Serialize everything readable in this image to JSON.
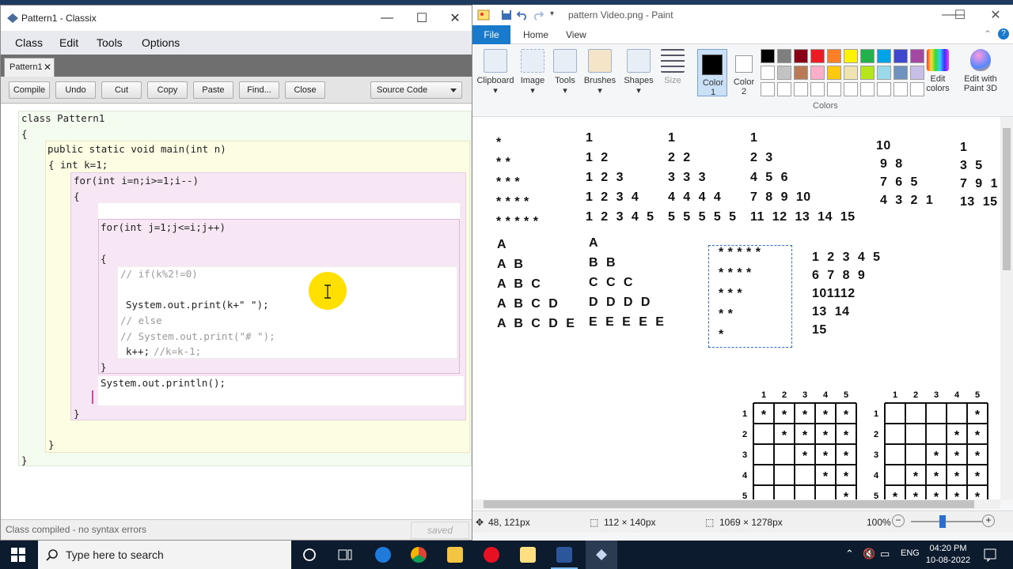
{
  "classix": {
    "title": "Pattern1 - Classix",
    "menu": [
      "Class",
      "Edit",
      "Tools",
      "Options"
    ],
    "tab_label": "Pattern1",
    "toolbar": {
      "compile": "Compile",
      "undo": "Undo",
      "cut": "Cut",
      "copy": "Copy",
      "paste": "Paste",
      "find": "Find...",
      "close": "Close",
      "view_select": "Source Code"
    },
    "code": {
      "l1": "class Pattern1",
      "l2": "{",
      "l3": "public static void main(int n)",
      "l4": "{ int k=1;",
      "l5": "for(int i=n;i>=1;i--)",
      "l6": "{",
      "l7": "for(int j=1;j<=i;j++)",
      "l8": "{",
      "l9": "// if(k%2!=0)",
      "l10": "System.out.print(k+\" \");",
      "l11": "// else",
      "l12": "// System.out.print(\"# \");",
      "l13": "k++;",
      "l13c": "//k=k-1;",
      "l14": "}",
      "l15": "System.out.println();",
      "l16": "}",
      "l17": "}",
      "l18": "}"
    },
    "status": "Class compiled - no syntax errors",
    "saved": "saved"
  },
  "paint": {
    "title": "pattern Video.png - Paint",
    "file_tab": "File",
    "tabs": [
      "Home",
      "View"
    ],
    "ribbon": {
      "clipboard": "Clipboard",
      "image": "Image",
      "tools": "Tools",
      "brushes": "Brushes",
      "shapes": "Shapes",
      "size": "Size",
      "color1": "Color\n1",
      "color2": "Color\n2",
      "edit_colors": "Edit\ncolors",
      "edit_paint3d": "Edit with\nPaint 3D",
      "colors_group": "Colors"
    },
    "palette_row1": [
      "#000000",
      "#7f7f7f",
      "#880015",
      "#ed1c24",
      "#ff7f27",
      "#fff200",
      "#22b14c",
      "#00a2e8",
      "#3f48cc",
      "#a349a4"
    ],
    "palette_row2": [
      "#ffffff",
      "#c3c3c3",
      "#b97a57",
      "#ffaec9",
      "#ffc90e",
      "#efe4b0",
      "#b5e61d",
      "#99d9ea",
      "#7092be",
      "#c8bfe7"
    ],
    "canvas": {
      "stars": [
        "*",
        "* *",
        "* * *",
        "* * * *",
        "* * * * *"
      ],
      "p2": [
        "1",
        "1  2",
        "1  2  3",
        "1  2  3  4",
        "1  2  3  4  5"
      ],
      "p3": [
        "1",
        "2  2",
        "3  3  3",
        "4  4  4  4",
        "5  5  5  5  5"
      ],
      "p4": [
        "1",
        "2  3",
        "4  5  6",
        "7  8  9  10",
        "11  12  13  14  15"
      ],
      "p5": [
        "10",
        " 9  8",
        " 7  6  5",
        " 4  3  2  1"
      ],
      "p6": [
        "1",
        "3  5",
        "7  9  1",
        "13  15"
      ],
      "p7": [
        "A",
        "A  B",
        "A  B  C",
        "A  B  C  D",
        "A  B  C  D  E"
      ],
      "p8": [
        "A",
        "B  B",
        "C  C  C",
        "D  D  D  D",
        "E  E  E  E  E"
      ],
      "p9": [
        "* * * * *",
        "* * * *",
        "* * *",
        "* *",
        "*"
      ],
      "p10": [
        "1  2  3  4  5",
        "6  7  8  9",
        "101112",
        "13  14",
        "15"
      ],
      "grid_cols": [
        "1",
        "2",
        "3",
        "4",
        "5"
      ],
      "grid_rows": [
        "1",
        "2",
        "3",
        "4",
        "5"
      ]
    },
    "status": {
      "cursor_pos": "48, 121px",
      "selection_size": "112 × 140px",
      "image_size": "1069 × 1278px",
      "zoom": "100%"
    }
  },
  "taskbar": {
    "search_placeholder": "Type here to search",
    "language": "ENG",
    "time": "04:20 PM",
    "date": "10-08-2022"
  }
}
